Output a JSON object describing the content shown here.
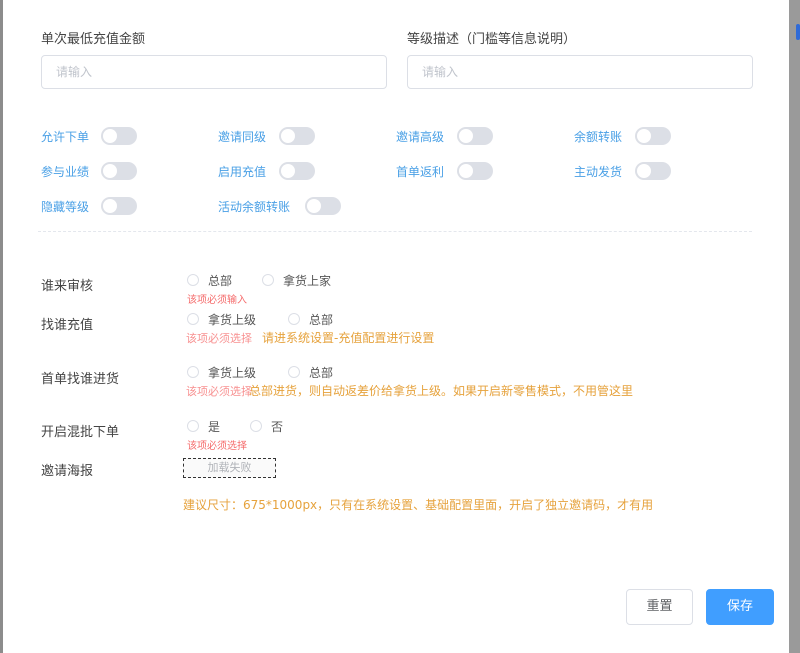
{
  "form": {
    "min_recharge": {
      "label": "单次最低充值金额",
      "placeholder": "请输入"
    },
    "level_desc": {
      "label": "等级描述（门槛等信息说明）",
      "placeholder": "请输入"
    }
  },
  "switches": [
    {
      "label": "允许下单",
      "on": false
    },
    {
      "label": "邀请同级",
      "on": false
    },
    {
      "label": "邀请高级",
      "on": false
    },
    {
      "label": "余额转账",
      "on": false
    },
    {
      "label": "参与业绩",
      "on": false
    },
    {
      "label": "启用充值",
      "on": false
    },
    {
      "label": "首单返利",
      "on": false
    },
    {
      "label": "主动发货",
      "on": false
    },
    {
      "label": "隐藏等级",
      "on": false
    },
    {
      "label": "活动余额转账",
      "on": false
    }
  ],
  "radio_rows": {
    "review": {
      "label": "谁来审核",
      "options": [
        "总部",
        "拿货上家"
      ],
      "error": "该项必须输入"
    },
    "recharge": {
      "label": "找谁充值",
      "options": [
        "拿货上级",
        "总部"
      ],
      "tip": "请进系统设置-充值配置进行设置",
      "overlap_text": "该项必须选择"
    },
    "first_order": {
      "label": "首单找谁进货",
      "options": [
        "拿货上级",
        "总部"
      ],
      "tip": "总部进货，则自动返差价给拿货上级。如果开启新零售模式，不用管这里",
      "overlap_text": "该项必须选择"
    },
    "mixed": {
      "label": "开启混批下单",
      "options": [
        "是",
        "否"
      ],
      "error": "该项必须选择"
    }
  },
  "poster": {
    "label": "邀请海报",
    "fail_text": "加载失败",
    "tip": "建议尺寸：675*1000px，只有在系统设置、基础配置里面，开启了独立邀请码，才有用"
  },
  "buttons": {
    "reset": "重置",
    "save": "保存"
  },
  "colors": {
    "primary": "#409eff",
    "warning": "#e6a23c",
    "danger": "#f56c6c",
    "switch_label": "#4aa0e6"
  }
}
